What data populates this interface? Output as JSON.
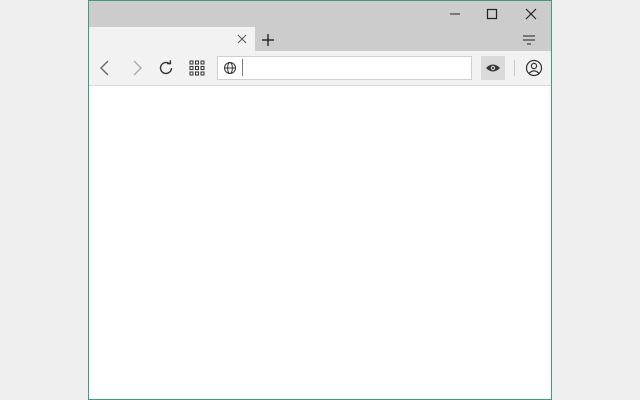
{
  "window": {
    "controls": {
      "minimize_icon": "minimize-icon",
      "maximize_icon": "maximize-icon",
      "close_icon": "close-icon"
    }
  },
  "tabs": [
    {
      "title": "",
      "active": true,
      "close_icon": "close-icon"
    }
  ],
  "tabstrip": {
    "new_tab_icon": "plus-icon",
    "tab_list_icon": "tab-list-icon"
  },
  "toolbar": {
    "back_icon": "chevron-left-icon",
    "forward_icon": "chevron-right-icon",
    "reload_icon": "reload-icon",
    "apps_icon": "apps-grid-icon",
    "address": {
      "value": "",
      "placeholder": "",
      "site_icon": "globe-icon"
    },
    "extension_icon": "eye-extension-icon",
    "profile_icon": "user-profile-icon"
  },
  "colors": {
    "window_border": "#3f9b7b",
    "titlebar": "#cccccc",
    "toolbar": "#f2f2f2",
    "desktop": "#efefef"
  }
}
